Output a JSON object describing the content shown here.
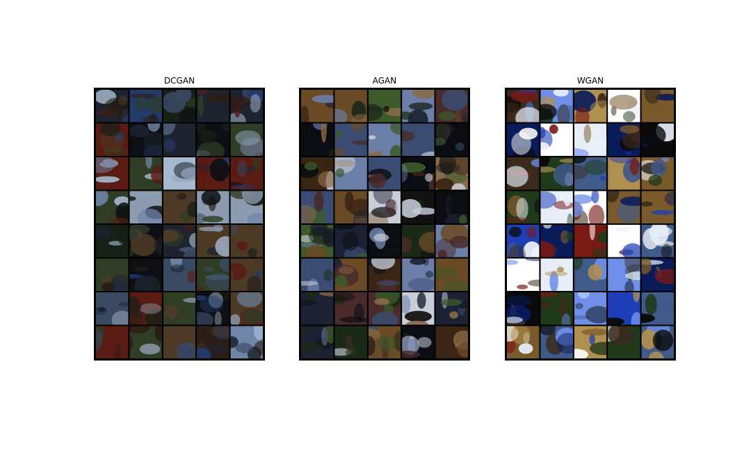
{
  "figure": {
    "panels": [
      {
        "id": "dcgan",
        "title": "DCGAN",
        "rows": 8,
        "cols": 5
      },
      {
        "id": "agan",
        "title": "AGAN",
        "rows": 8,
        "cols": 5
      },
      {
        "id": "wgan",
        "title": "WGAN",
        "rows": 8,
        "cols": 5
      }
    ]
  }
}
